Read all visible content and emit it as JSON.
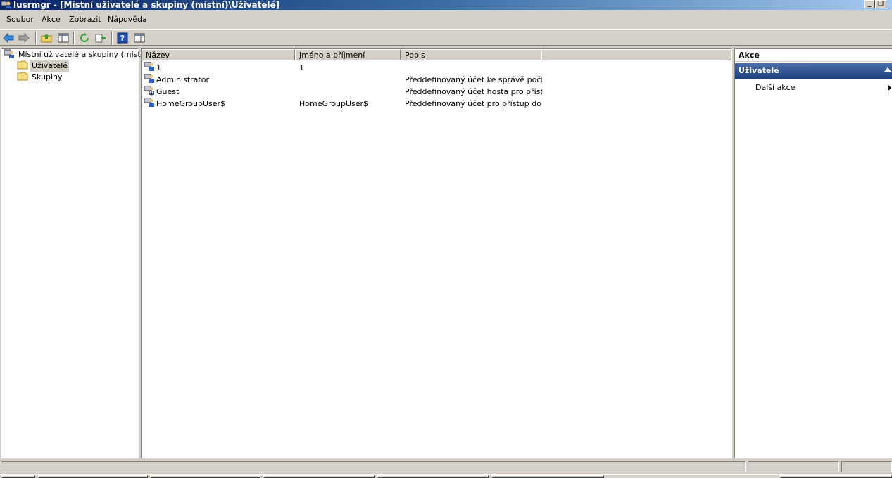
{
  "window": {
    "title": "lusrmgr - [Místní uživatelé a skupiny (místní)\\Uživatelé]",
    "minimize_label": "_",
    "restore_label": "❐"
  },
  "menu": {
    "items": [
      "Soubor",
      "Akce",
      "Zobrazit",
      "Nápověda"
    ]
  },
  "toolbar": {
    "buttons": [
      "back-icon",
      "forward-icon",
      "up-folder-icon",
      "show-hide-tree-icon",
      "refresh-icon",
      "export-list-icon",
      "help-icon",
      "show-hide-action-pane-icon"
    ]
  },
  "tree": {
    "root": "Místní uživatelé a skupiny (místní)",
    "children": [
      {
        "label": "Uživatelé",
        "selected": true
      },
      {
        "label": "Skupiny",
        "selected": false
      }
    ]
  },
  "list": {
    "columns": [
      "Název",
      "Jméno a příjmení",
      "Popis"
    ],
    "rows": [
      {
        "name": "1",
        "fullname": "1",
        "description": "",
        "icon": "user-icon"
      },
      {
        "name": "Administrator",
        "fullname": "",
        "description": "Předdefinovaný účet ke správě počít…",
        "icon": "user-icon"
      },
      {
        "name": "Guest",
        "fullname": "",
        "description": "Předdefinovaný účet hosta pro příst…",
        "icon": "disabled-user-icon"
      },
      {
        "name": "HomeGroupUser$",
        "fullname": "HomeGroupUser$",
        "description": "Předdefinovaný účet pro přístup do…",
        "icon": "user-icon"
      }
    ]
  },
  "actions": {
    "header": "Akce",
    "section": "Uživatelé",
    "items": [
      "Další akce"
    ]
  },
  "colors": {
    "title_start": "#0a246a",
    "title_end": "#a6caf0",
    "window_bg": "#d4d0c8",
    "action_section": "#1f3f7f"
  }
}
